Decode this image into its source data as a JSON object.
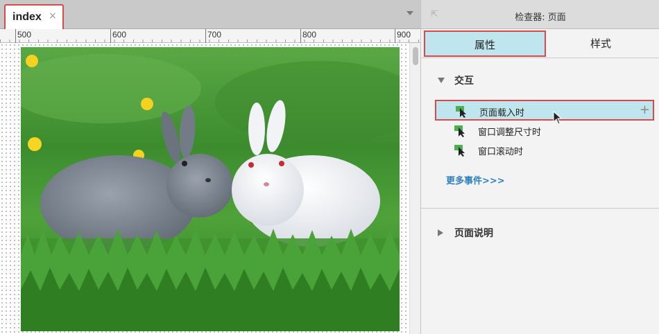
{
  "document_tab": {
    "label": "index",
    "close": "×"
  },
  "ruler": {
    "labels": [
      "500",
      "600",
      "700",
      "800",
      "900"
    ]
  },
  "canvas": {
    "image_subject": "two rabbits on grass"
  },
  "inspector": {
    "title": "检查器: 页面",
    "tabs": {
      "properties": "属性",
      "style": "样式"
    },
    "interactions": {
      "heading": "交互",
      "events": [
        "页面载入时",
        "窗口调整尺寸时",
        "窗口滚动时"
      ],
      "selected_index": 0,
      "add_symbol": "+",
      "more_link": "更多事件>>>"
    },
    "page_notes": {
      "heading": "页面说明"
    }
  },
  "colors": {
    "highlight": "#d84a4a",
    "selection": "#bfe5ee",
    "link": "#2c7fc0",
    "event_icon": "#4caf50"
  }
}
